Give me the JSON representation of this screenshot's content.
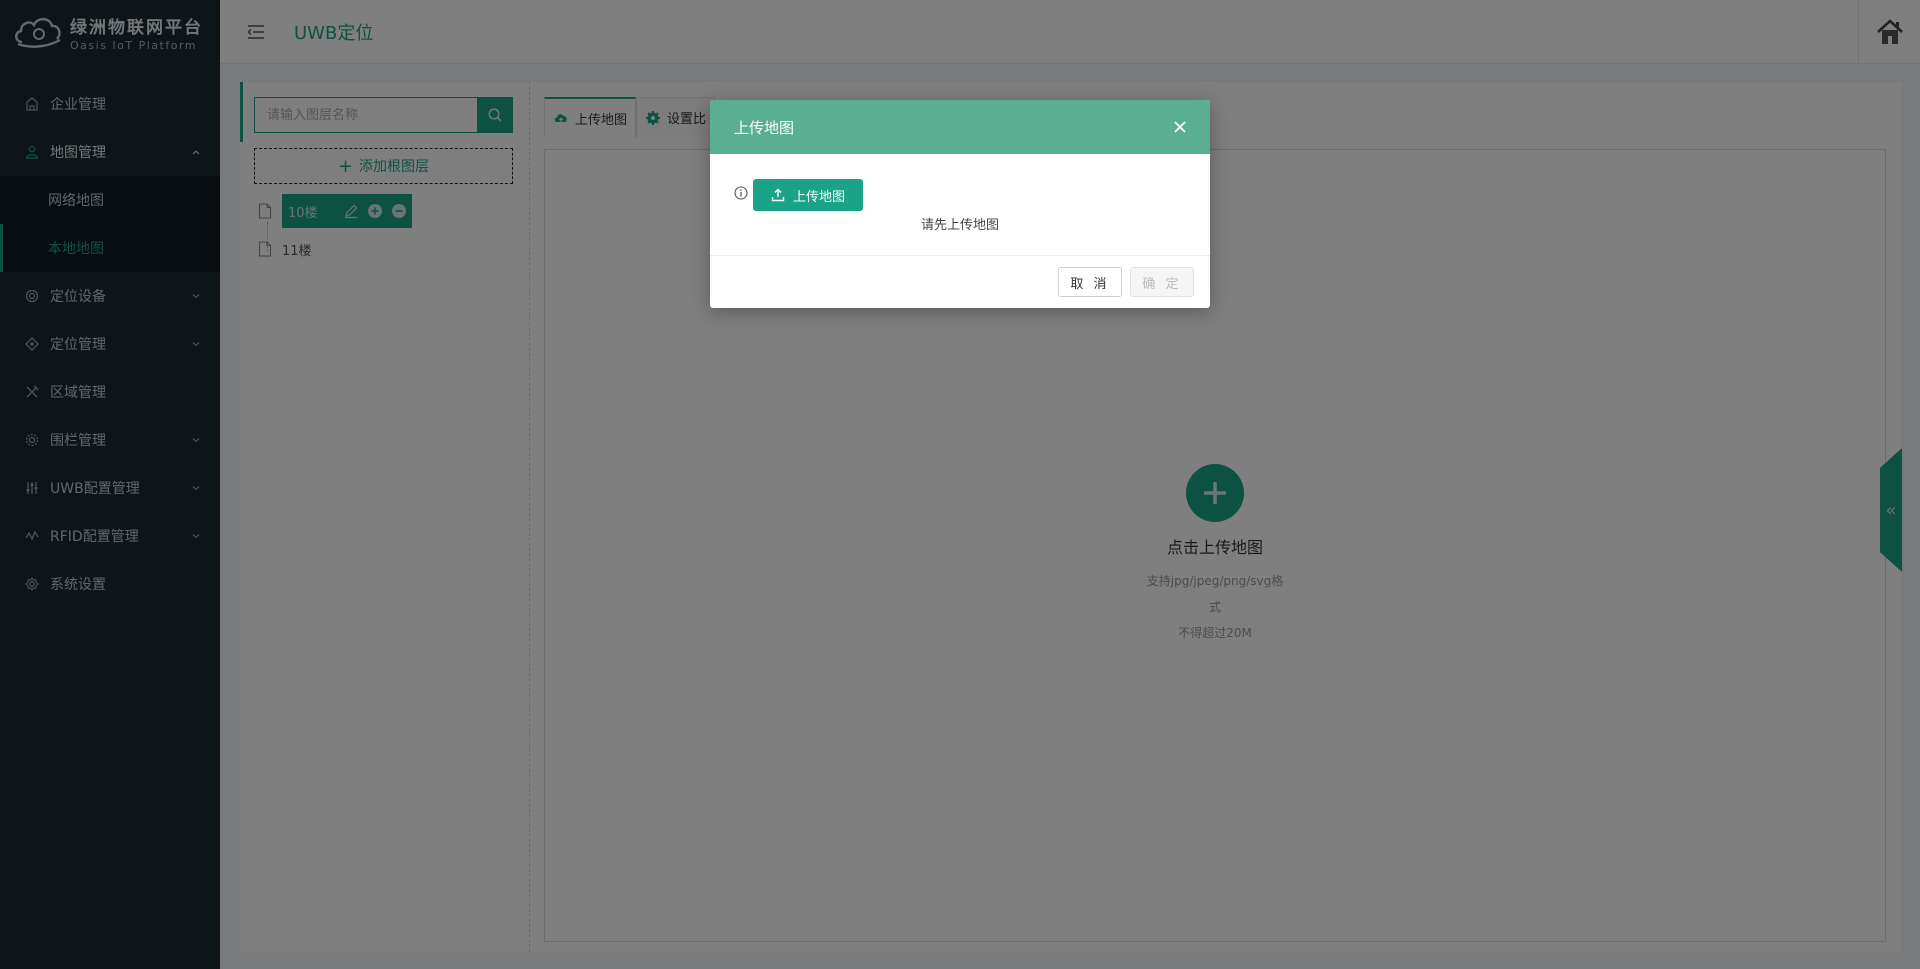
{
  "app": {
    "title": "绿洲物联网平台",
    "subtitle": "Oasis IoT Platform"
  },
  "sidebar": {
    "items": [
      {
        "label": "企业管理",
        "icon": "building-icon",
        "has_children": false
      },
      {
        "label": "地图管理",
        "icon": "map-user-icon",
        "has_children": true,
        "expanded": true,
        "children": [
          {
            "label": "网络地图",
            "active": false
          },
          {
            "label": "本地地图",
            "active": true
          }
        ]
      },
      {
        "label": "定位设备",
        "icon": "target-icon",
        "has_children": true
      },
      {
        "label": "定位管理",
        "icon": "crosshair-icon",
        "has_children": true
      },
      {
        "label": "区域管理",
        "icon": "tools-icon",
        "has_children": false
      },
      {
        "label": "围栏管理",
        "icon": "fence-icon",
        "has_children": true
      },
      {
        "label": "UWB配置管理",
        "icon": "sliders-icon",
        "has_children": true
      },
      {
        "label": "RFID配置管理",
        "icon": "wave-icon",
        "has_children": true
      },
      {
        "label": "系统设置",
        "icon": "gear-icon",
        "has_children": false
      }
    ]
  },
  "header": {
    "title": "UWB定位",
    "menu_icon": "hamburger-icon",
    "home_icon": "home-icon"
  },
  "layer_panel": {
    "search_placeholder": "请输入图层名称",
    "add_root_label": "添加根图层",
    "nodes": [
      {
        "label": "10楼",
        "selected": true
      },
      {
        "label": "11楼",
        "selected": false
      }
    ]
  },
  "tabs": [
    {
      "label": "上传地图",
      "icon": "cloud-upload-icon",
      "active": true
    },
    {
      "label": "设置比",
      "icon": "gear-icon",
      "active": false
    }
  ],
  "canvas": {
    "upload_title": "点击上传地图",
    "hint_formats": "支持jpg/jpeg/png/svg格式",
    "hint_size": "不得超过20M"
  },
  "modal": {
    "title": "上传地图",
    "upload_button": "上传地图",
    "message": "请先上传地图",
    "cancel": "取 消",
    "ok": "确 定"
  },
  "colors": {
    "accent": "#1aa386",
    "sidebar_bg": "#1c2a33",
    "modal_header": "#5aaf92"
  }
}
